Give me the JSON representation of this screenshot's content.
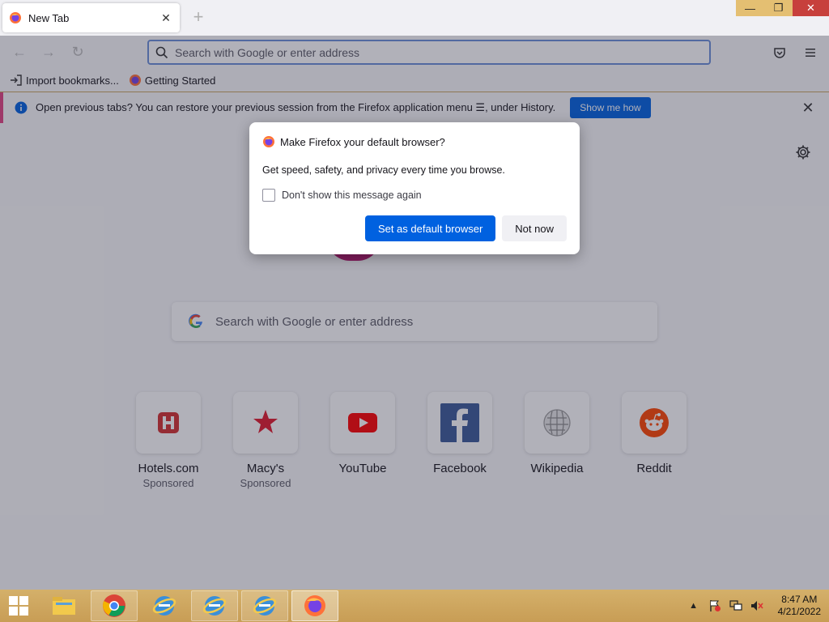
{
  "browser": {
    "tab": {
      "title": "New Tab",
      "close_icon": "close-icon"
    },
    "new_tab_icon": "plus-icon",
    "window_controls": {
      "minimize": "—",
      "restore": "❐",
      "close": "✕"
    },
    "nav": {
      "back": "←",
      "forward": "→",
      "reload": "↻",
      "url_placeholder": "Search with Google or enter address"
    },
    "bookmarks": [
      {
        "label": "Import bookmarks...",
        "icon": "import-icon"
      },
      {
        "label": "Getting Started",
        "icon": "firefox-icon"
      }
    ],
    "notification": {
      "text": "Open previous tabs? You can restore your previous session from the Firefox application menu ☰, under History.",
      "button": "Show me how",
      "close": "✕"
    }
  },
  "newtab": {
    "search_placeholder": "Search with Google or enter address",
    "top_sites": [
      {
        "title": "Hotels.com",
        "sponsored": "Sponsored",
        "icon": "hotels-icon",
        "color": "#d32f2f"
      },
      {
        "title": "Macy's",
        "sponsored": "Sponsored",
        "icon": "macys-star-icon",
        "color": "#e21a2c"
      },
      {
        "title": "YouTube",
        "sponsored": "",
        "icon": "youtube-icon",
        "color": "#ff0000"
      },
      {
        "title": "Facebook",
        "sponsored": "",
        "icon": "facebook-icon",
        "color": "#3b5998"
      },
      {
        "title": "Wikipedia",
        "sponsored": "",
        "icon": "wikipedia-globe-icon",
        "color": "#777777"
      },
      {
        "title": "Reddit",
        "sponsored": "",
        "icon": "reddit-icon",
        "color": "#ff4500"
      }
    ]
  },
  "dialog": {
    "title": "Make Firefox your default browser?",
    "body": "Get speed, safety, and privacy every time you browse.",
    "checkbox_label": "Don't show this message again",
    "checkbox_checked": false,
    "primary_button": "Set as default browser",
    "secondary_button": "Not now"
  },
  "taskbar": {
    "apps": [
      {
        "name": "file-explorer-icon",
        "state": "pinned"
      },
      {
        "name": "chrome-icon",
        "state": "open"
      },
      {
        "name": "ie-icon",
        "state": "pinned"
      },
      {
        "name": "ie-icon",
        "state": "open"
      },
      {
        "name": "ie-icon",
        "state": "open"
      },
      {
        "name": "firefox-icon",
        "state": "active"
      }
    ],
    "time": "8:47 AM",
    "date": "4/21/2022"
  },
  "colors": {
    "accent": "#0061e0",
    "notification_stripe": "#e24482",
    "taskbar": "#c89d55"
  }
}
